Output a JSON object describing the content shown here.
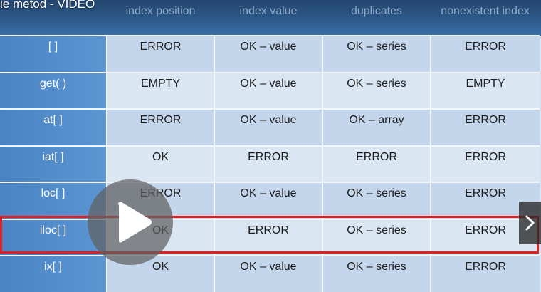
{
  "video": {
    "title": "ie metod - VIDEO"
  },
  "table": {
    "headers": [
      "index position",
      "index value",
      "duplicates",
      "nonexistent index"
    ],
    "rows": [
      {
        "method": "[ ]",
        "cells": [
          "ERROR",
          "OK – value",
          "OK – series",
          "ERROR"
        ]
      },
      {
        "method": "get( )",
        "cells": [
          "EMPTY",
          "OK – value",
          "OK – series",
          "EMPTY"
        ]
      },
      {
        "method": "at[ ]",
        "cells": [
          "ERROR",
          "OK – value",
          "OK – array",
          "ERROR"
        ]
      },
      {
        "method": "iat[ ]",
        "cells": [
          "OK",
          "ERROR",
          "ERROR",
          "ERROR"
        ]
      },
      {
        "method": "loc[ ]",
        "cells": [
          "ERROR",
          "OK – value",
          "OK – series",
          "ERROR"
        ]
      },
      {
        "method": "iloc[ ]",
        "cells": [
          "OK",
          "ERROR",
          "OK – series",
          "ERROR"
        ]
      },
      {
        "method": "ix[ ]",
        "cells": [
          "OK",
          "OK – value",
          "OK – series",
          "ERROR"
        ]
      }
    ],
    "highlighted_row": "iloc[ ]"
  },
  "controls": {
    "play_icon": "play-icon",
    "next_icon": "chevron-right-icon"
  },
  "colors": {
    "highlight_border": "#e21e1e",
    "method_column": "#5b95d2",
    "header": "#2c5a8b"
  }
}
